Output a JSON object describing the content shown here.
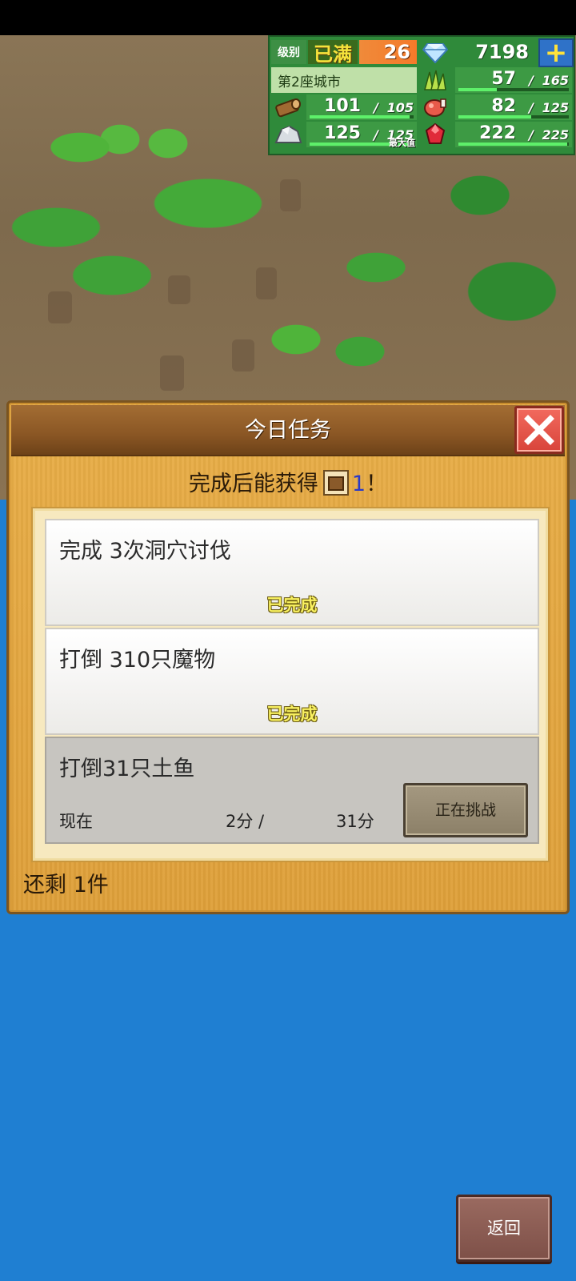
{
  "hud": {
    "level_label": "级别",
    "level_status": "已满",
    "level_value": "26",
    "gems": "7198",
    "plus": "+",
    "city_name": "第2座城市",
    "resources": [
      {
        "name": "grass",
        "icon": "grass-icon",
        "value": "57",
        "max": "165",
        "fill": 0.345
      },
      {
        "name": "wood",
        "icon": "log-icon",
        "value": "101",
        "max": "105",
        "fill": 0.96
      },
      {
        "name": "food",
        "icon": "meat-icon",
        "value": "82",
        "max": "125",
        "fill": 0.656
      },
      {
        "name": "ore",
        "icon": "ore-icon",
        "value": "125",
        "max": "125",
        "fill": 1.0,
        "tag": "最大值"
      },
      {
        "name": "ruby",
        "icon": "ruby-icon",
        "value": "222",
        "max": "225",
        "fill": 0.987
      }
    ]
  },
  "dialog": {
    "title": "今日任务",
    "reward_prefix": "完成后能获得",
    "reward_count": "1",
    "reward_suffix": "！",
    "tasks": [
      {
        "name": "完成 3次洞穴讨伐",
        "status": "已完成"
      },
      {
        "name": "打倒 310只魔物",
        "status": "已完成"
      },
      {
        "name": "打倒31只土鱼",
        "now_label": "现在",
        "current": "2分 /",
        "goal": "31分",
        "button": "正在挑战"
      }
    ],
    "remaining": "还剩 1件"
  },
  "back_button": "返回",
  "colors": {
    "ocean": "#1f7fd2",
    "dialog_bg": "#e2a741",
    "header_bg": "#8a5624",
    "close_red": "#d8443a",
    "hud_green": "#2f8a3a"
  }
}
